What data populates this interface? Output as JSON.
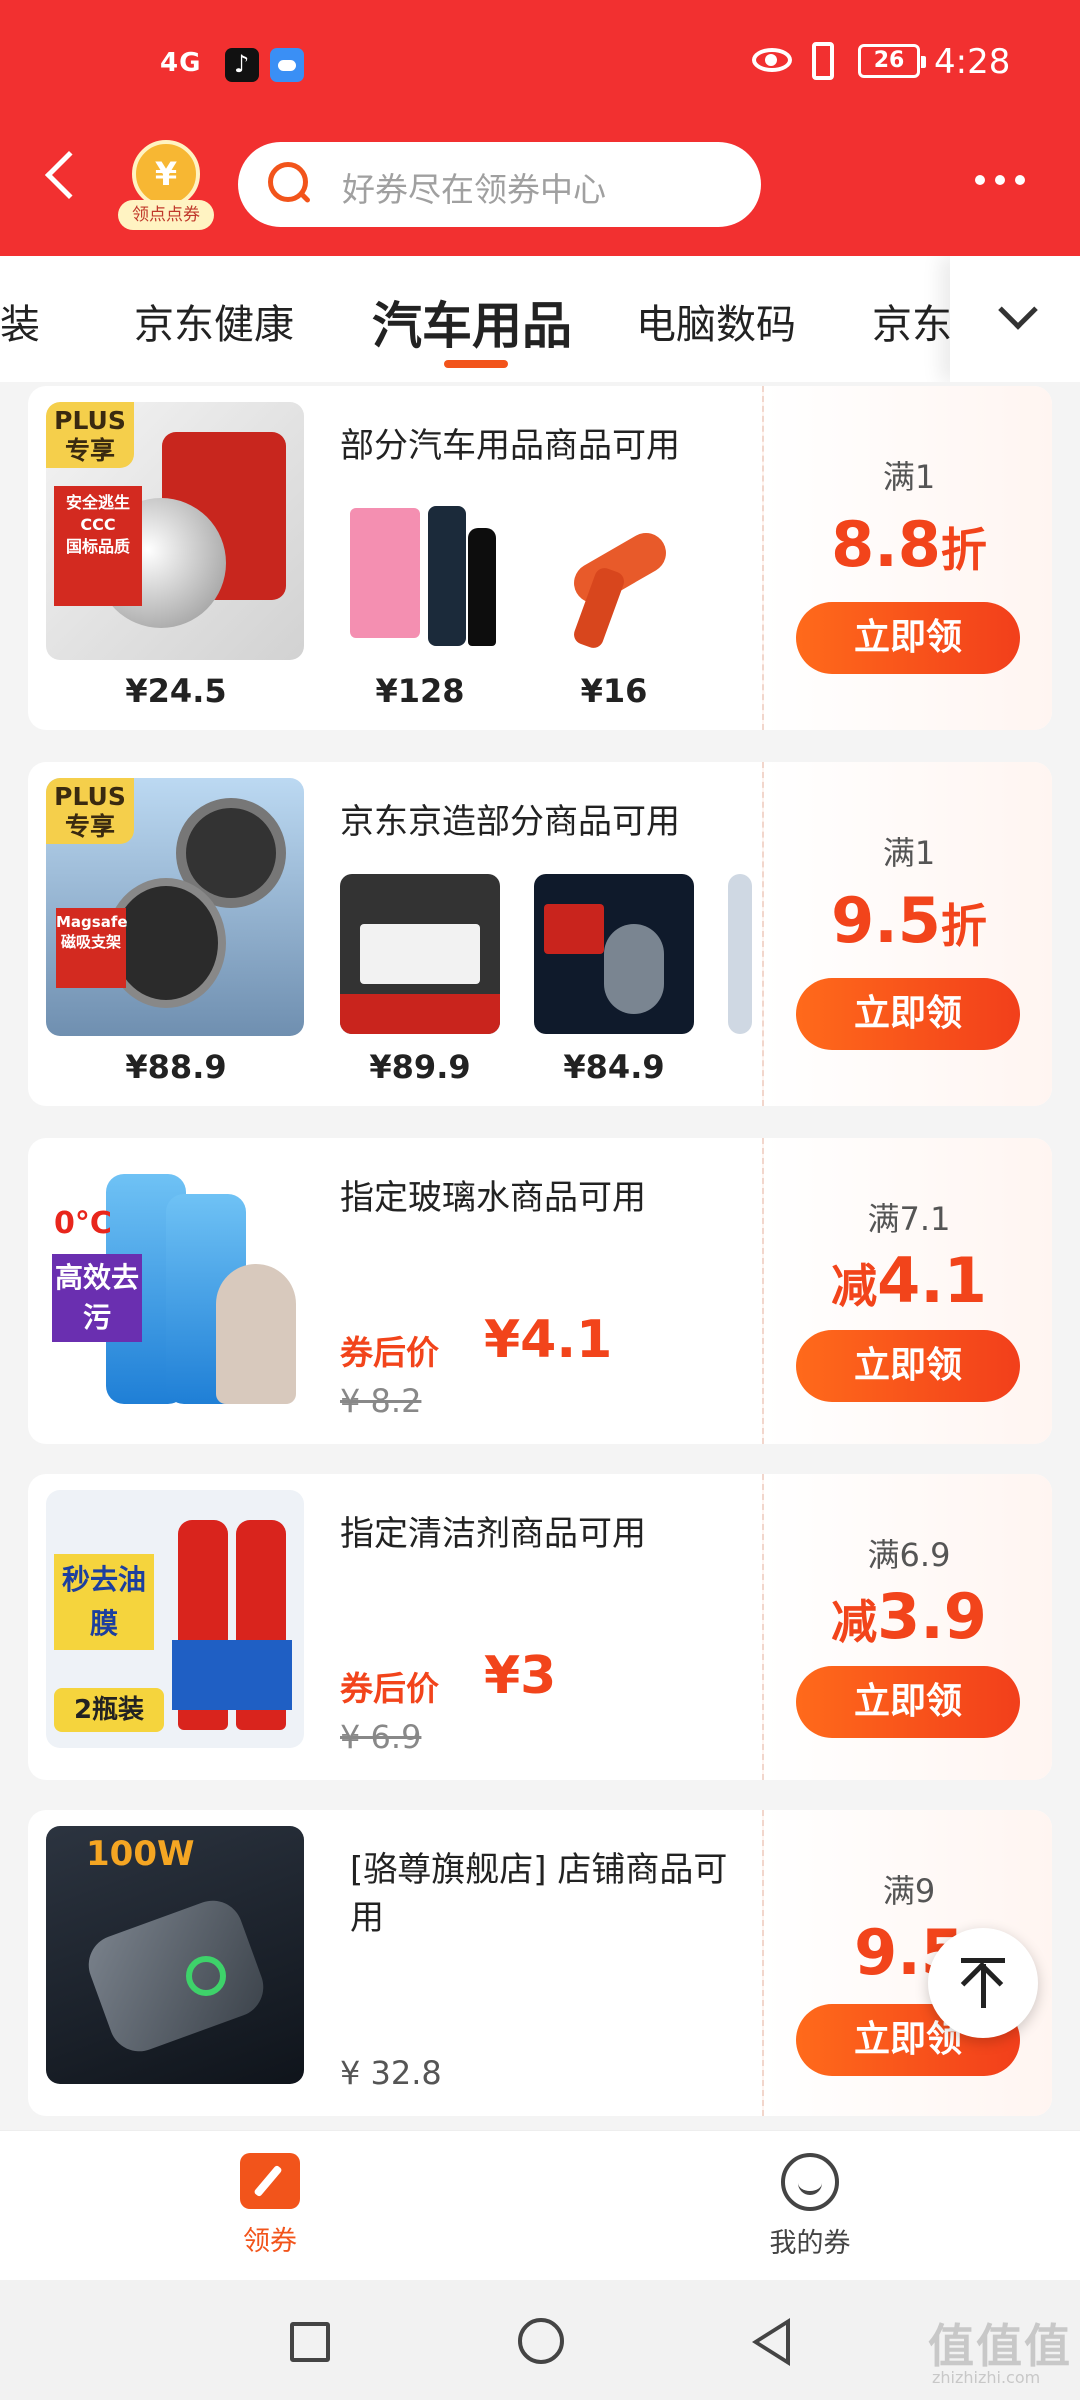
{
  "status_bar": {
    "signal": "4G",
    "battery": "26",
    "time": "4:28"
  },
  "header": {
    "badge_label": "领点点券",
    "coin_symbol": "¥",
    "search_placeholder": "好券尽在领券中心"
  },
  "tabs": [
    "童装",
    "京东健康",
    "汽车用品",
    "电脑数码",
    "京东"
  ],
  "active_tab": "汽车用品",
  "cards": [
    {
      "title": "部分汽车用品商品可用",
      "condition": "满1",
      "discount_value": "8.8",
      "discount_unit": "折",
      "button": "立即领",
      "plus": "PLUS 专享",
      "main_price": "¥24.5",
      "prices": [
        "¥128",
        "¥16"
      ]
    },
    {
      "title": "京东京造部分商品可用",
      "condition": "满1",
      "discount_value": "9.5",
      "discount_unit": "折",
      "button": "立即领",
      "plus": "PLUS 专享",
      "main_price": "¥88.9",
      "prices": [
        "¥89.9",
        "¥84.9"
      ]
    },
    {
      "title": "指定玻璃水商品可用",
      "condition": "满7.1",
      "discount_prefix": "减",
      "discount_value": "4.1",
      "button": "立即领",
      "after_label": "券后价",
      "after_price": "¥4.1",
      "orig_price": "¥ 8.2",
      "art_text": "高效去污",
      "art_temp": "0°C"
    },
    {
      "title": "指定清洁剂商品可用",
      "condition": "满6.9",
      "discount_prefix": "减",
      "discount_value": "3.9",
      "button": "立即领",
      "after_label": "券后价",
      "after_price": "¥3",
      "orig_price": "¥ 6.9",
      "art_text": "秒去油膜",
      "art_count": "2瓶装"
    },
    {
      "title": "[骆尊旗舰店] 店铺商品可用",
      "condition": "满9",
      "discount_value": "9.5",
      "button": "立即领",
      "plain_price": "¥ 32.8",
      "art_text": "100W"
    }
  ],
  "bottom_nav": {
    "coupons": "领券",
    "my_coupons": "我的券"
  },
  "watermark": {
    "main": "值值值",
    "sub": "zhizhizhi.com"
  },
  "colors": {
    "brand_red": "#f23030",
    "accent_orange": "#f2541b"
  }
}
